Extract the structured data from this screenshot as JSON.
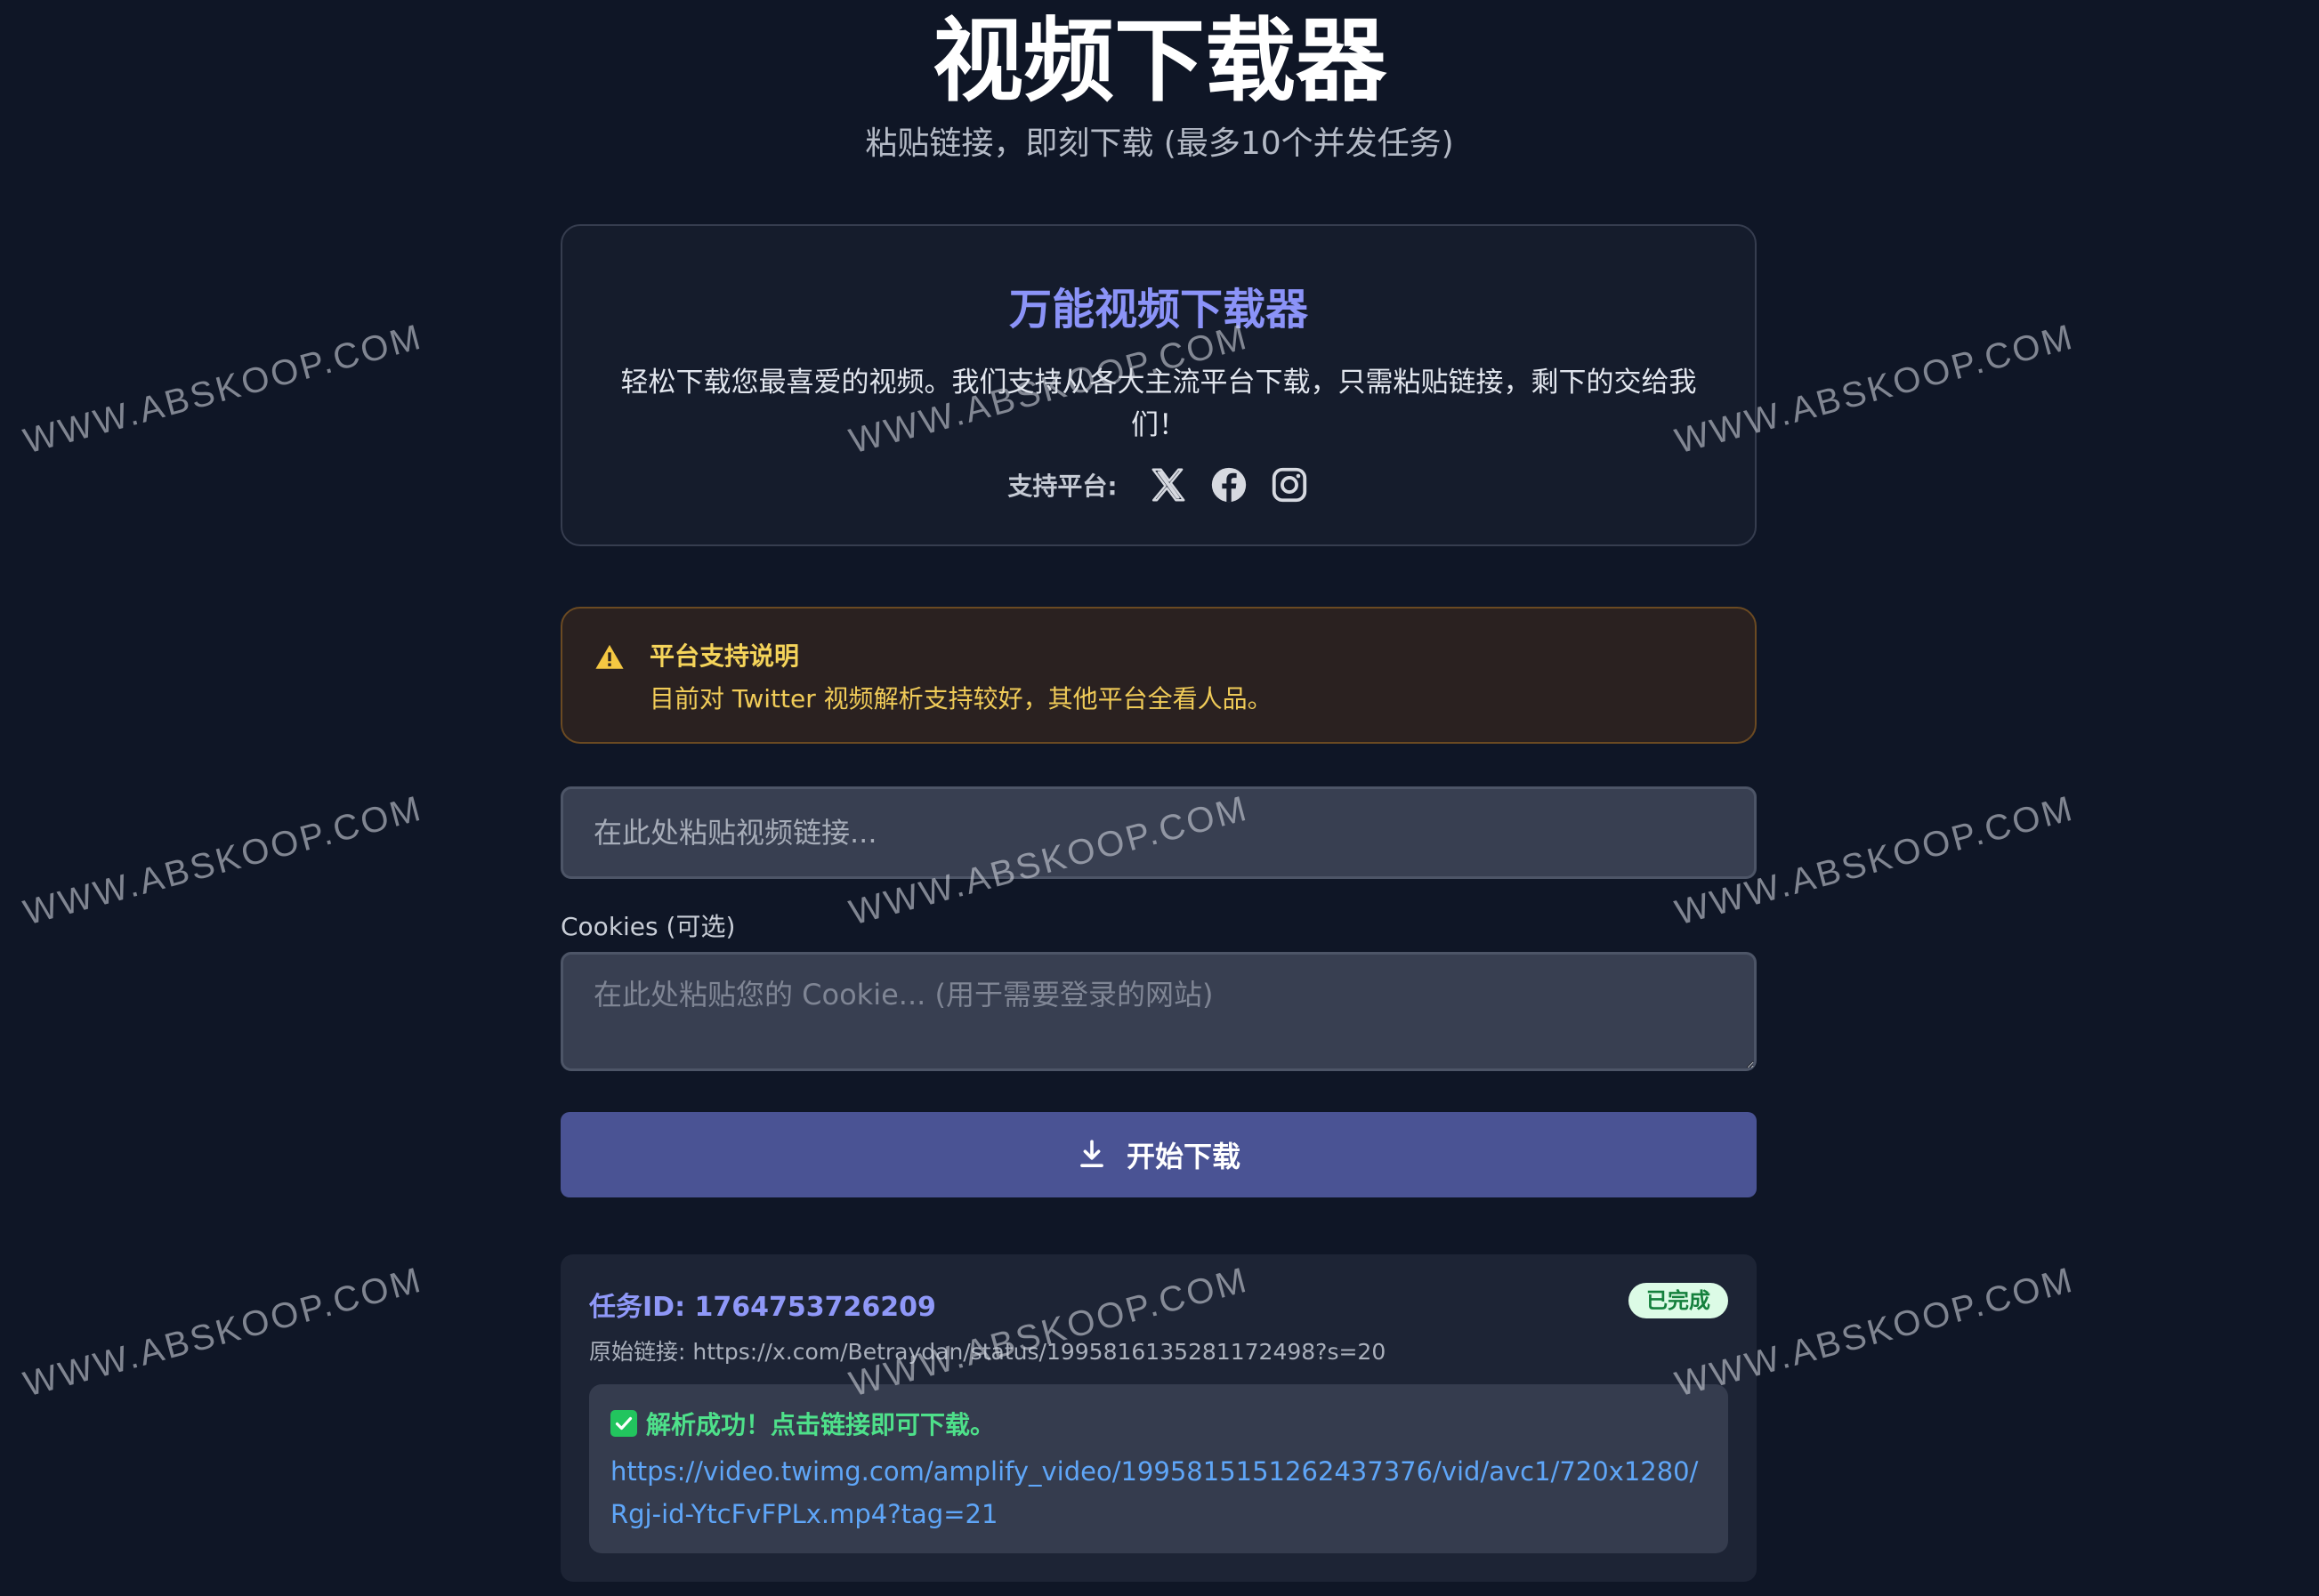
{
  "header": {
    "title": "视频下载器",
    "subtitle": "粘贴链接，即刻下载 (最多10个并发任务)"
  },
  "intro": {
    "title": "万能视频下载器",
    "description": "轻松下载您最喜爱的视频。我们支持从各大主流平台下载，只需粘贴链接，剩下的交给我们！",
    "platforms_label": "支持平台:",
    "platform_icons": [
      "x-twitter-icon",
      "facebook-icon",
      "instagram-icon"
    ]
  },
  "notice": {
    "icon": "warning-icon",
    "title": "平台支持说明",
    "text": "目前对 Twitter 视频解析支持较好，其他平台全看人品。"
  },
  "form": {
    "url_placeholder": "在此处粘贴视频链接...",
    "url_value": "",
    "cookies_label": "Cookies (可选)",
    "cookies_placeholder": "在此处粘贴您的 Cookie... (用于需要登录的网站)",
    "cookies_value": "",
    "download_button": "开始下载"
  },
  "task": {
    "id_text": "任务ID: 1764753726209",
    "status": "已完成",
    "original_link": "原始链接: https://x.com/Betraydan/status/1995816135281172498?s=20",
    "result_message": "解析成功！点击链接即可下载。",
    "result_url": "https://video.twimg.com/amplify_video/1995815151262437376/vid/avc1/720x1280/Rgj-id-YtcFvFPLx.mp4?tag=21"
  },
  "watermark": "WWW.ABSKOOP.COM",
  "colors": {
    "background": "#0f1626",
    "accent": "#8b93f8",
    "button": "#4a5394",
    "warning": "#f5d45a",
    "success": "#4ee08a",
    "link": "#5fa6f8"
  }
}
